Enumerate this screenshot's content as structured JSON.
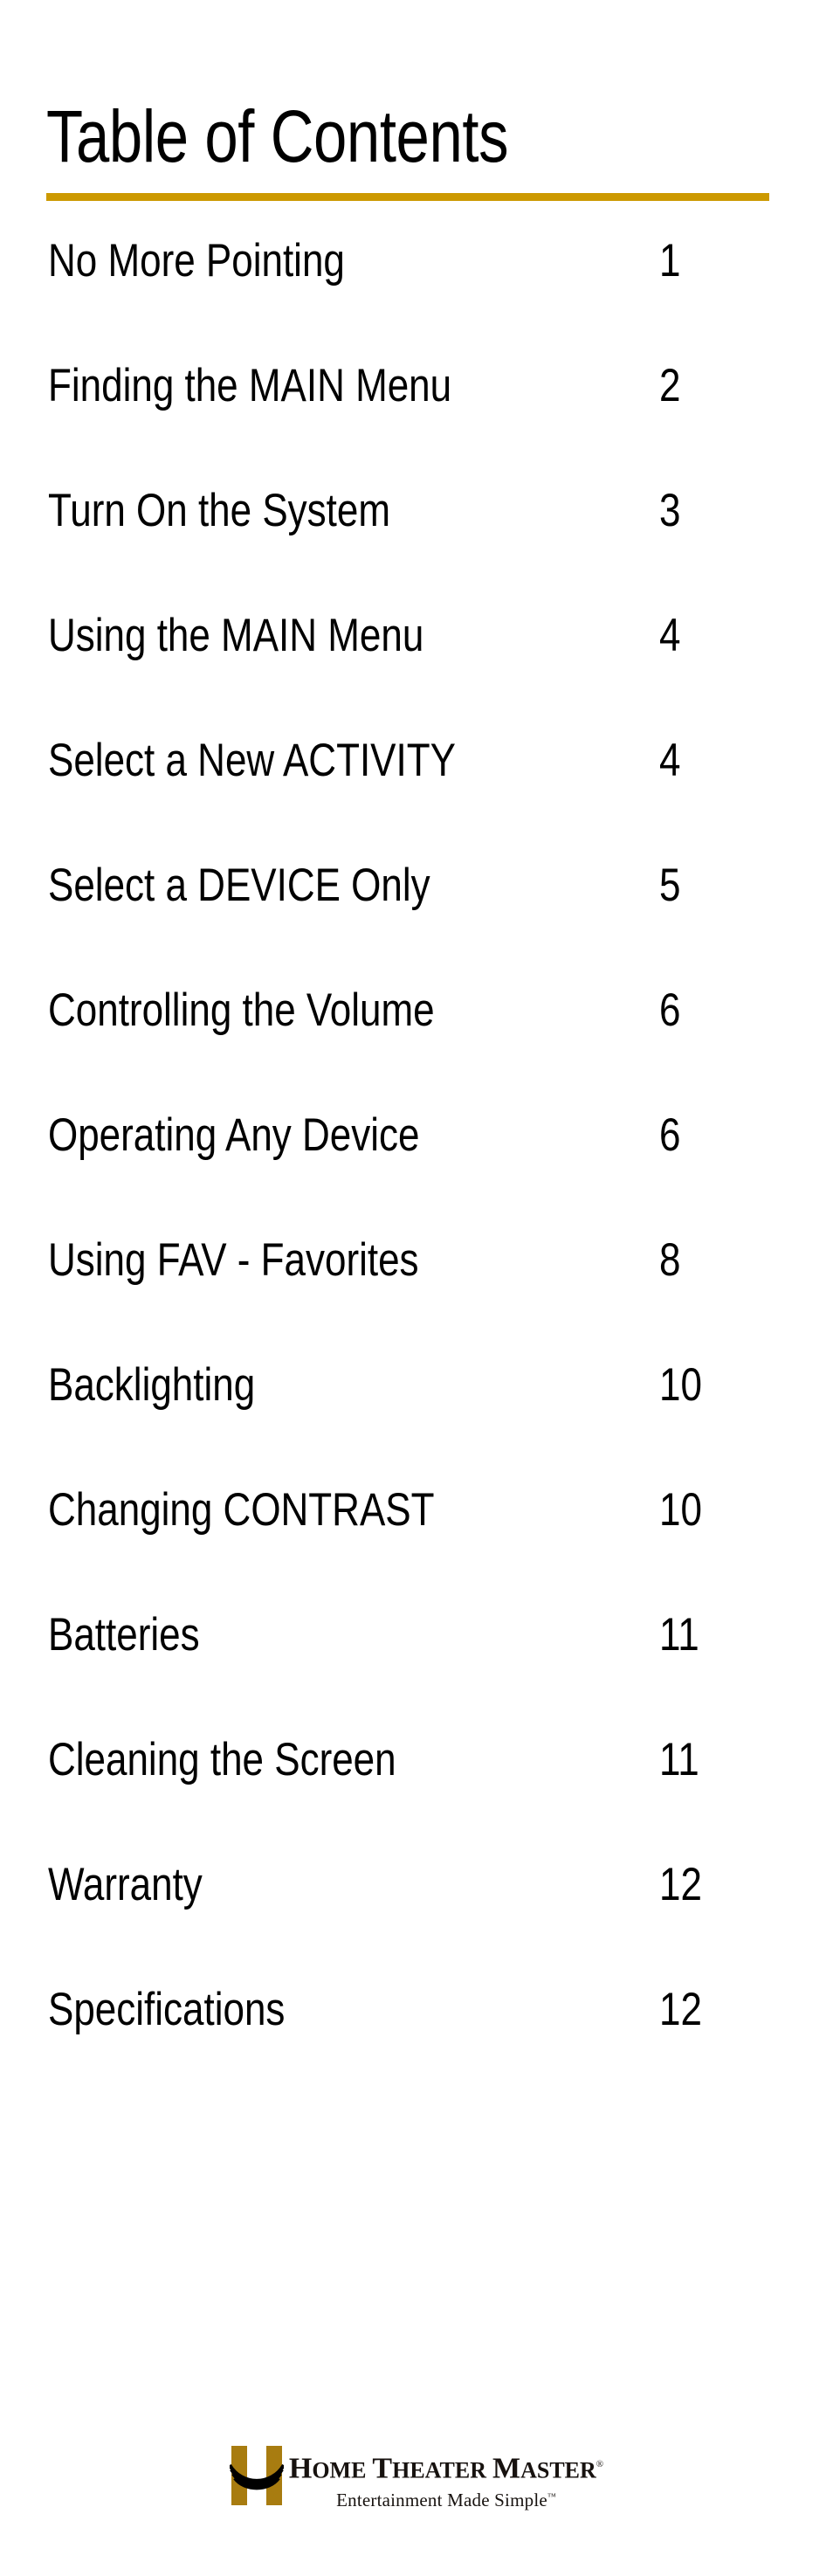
{
  "page": {
    "background_color": "#ffffff",
    "accent_color": "#cc9900",
    "logo_mark_color": "#a87c10",
    "text_color": "#000000"
  },
  "header": {
    "title": "Table of Contents"
  },
  "toc": {
    "entries": [
      {
        "label": "No More Pointing",
        "page": "1"
      },
      {
        "label": "Finding the MAIN Menu",
        "page": "2"
      },
      {
        "label": "Turn On the System",
        "page": "3"
      },
      {
        "label": "Using the MAIN Menu",
        "page": "4"
      },
      {
        "label": "Select a New ACTIVITY",
        "page": "4"
      },
      {
        "label": "Select a DEVICE Only",
        "page": "5"
      },
      {
        "label": "Controlling the Volume",
        "page": "6"
      },
      {
        "label": "Operating Any Device",
        "page": "6"
      },
      {
        "label": "Using FAV - Favorites",
        "page": "8"
      },
      {
        "label": "Backlighting",
        "page": "10"
      },
      {
        "label": "Changing CONTRAST",
        "page": "10"
      },
      {
        "label": "Batteries",
        "page": "11"
      },
      {
        "label": "Cleaning the Screen",
        "page": "11"
      },
      {
        "label": "Warranty",
        "page": "12"
      },
      {
        "label": "Specifications",
        "page": "12"
      }
    ]
  },
  "footer": {
    "logo": {
      "mark_icon": "home-theater-master-h-icon",
      "wordmark_parts": [
        {
          "cap": "H",
          "rest": "OME"
        },
        {
          "cap": "T",
          "rest": "HEATER"
        },
        {
          "cap": "M",
          "rest": "ASTER"
        }
      ],
      "wordmark_plain": "HOME THEATER MASTER",
      "registered_mark": "®",
      "tagline": "Entertainment Made Simple",
      "trademark_mark": "™"
    }
  }
}
